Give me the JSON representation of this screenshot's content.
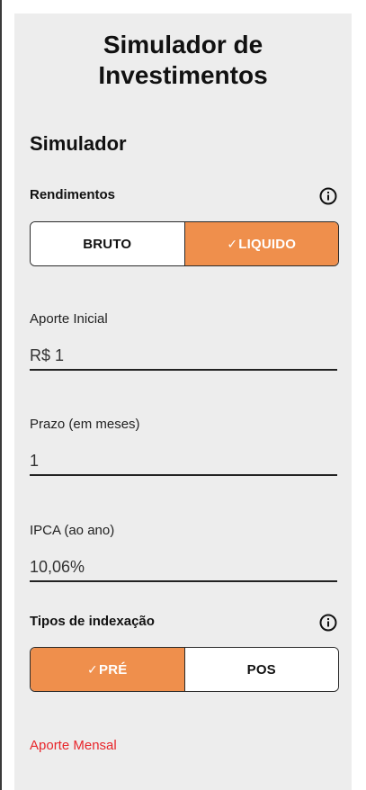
{
  "page": {
    "title": "Simulador de\nInvestimentos"
  },
  "simulator": {
    "section_title": "Simulador",
    "rendimentos": {
      "label": "Rendimentos",
      "info_icon": "info-icon",
      "options": {
        "bruto": "BRUTO",
        "liquido": "LIQUIDO"
      },
      "selected": "liquido",
      "check_glyph": "✓"
    },
    "aporte_inicial": {
      "label": "Aporte Inicial",
      "value": "R$ 1"
    },
    "prazo": {
      "label": "Prazo (em meses)",
      "value": "1"
    },
    "ipca": {
      "label": "IPCA (ao ano)",
      "value": "10,06%"
    },
    "indexacao": {
      "label": "Tipos de indexação",
      "info_icon": "info-icon",
      "options": {
        "pre": "PRÉ",
        "pos": "POS"
      },
      "selected": "pre",
      "check_glyph": "✓"
    },
    "aporte_mensal": {
      "label": "Aporte Mensal"
    }
  },
  "colors": {
    "accent": "#ef8f4c",
    "panel_bg": "#ededed",
    "error_text": "#e8262b"
  }
}
